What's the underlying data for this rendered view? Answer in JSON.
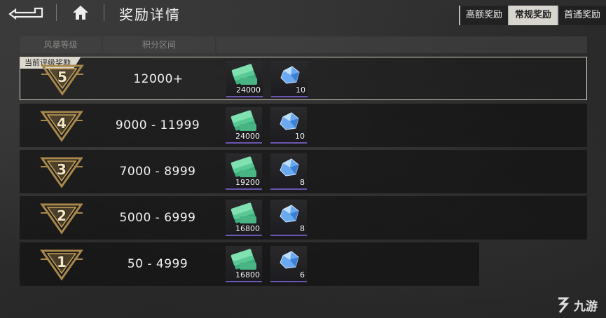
{
  "header": {
    "title": "奖励详情",
    "tabs": [
      {
        "label": "高额奖励",
        "active": false
      },
      {
        "label": "常规奖励",
        "active": true
      },
      {
        "label": "首通奖励",
        "active": false
      }
    ]
  },
  "table": {
    "columns": [
      "风暴等级",
      "积分区间"
    ],
    "current_label": "当前评级奖励",
    "rows": [
      {
        "rank": "5",
        "range": "12000+",
        "money": "24000",
        "gem": "10",
        "current": true
      },
      {
        "rank": "4",
        "range": "9000 - 11999",
        "money": "24000",
        "gem": "10",
        "current": false
      },
      {
        "rank": "3",
        "range": "7000 - 8999",
        "money": "19200",
        "gem": "8",
        "current": false
      },
      {
        "rank": "2",
        "range": "5000 - 6999",
        "money": "16800",
        "gem": "8",
        "current": false
      },
      {
        "rank": "1",
        "range": "50 - 4999",
        "money": "16800",
        "gem": "6",
        "current": false
      }
    ]
  },
  "watermark": {
    "text": "九游"
  },
  "colors": {
    "accent": "#c9a45a",
    "active_tab": "#d8d6cf",
    "reward_border": "#6a55b0"
  },
  "icons": {
    "back": "back-arrow-icon",
    "home": "home-icon",
    "money": "cash-stack-icon",
    "gem": "blue-crystal-icon"
  }
}
